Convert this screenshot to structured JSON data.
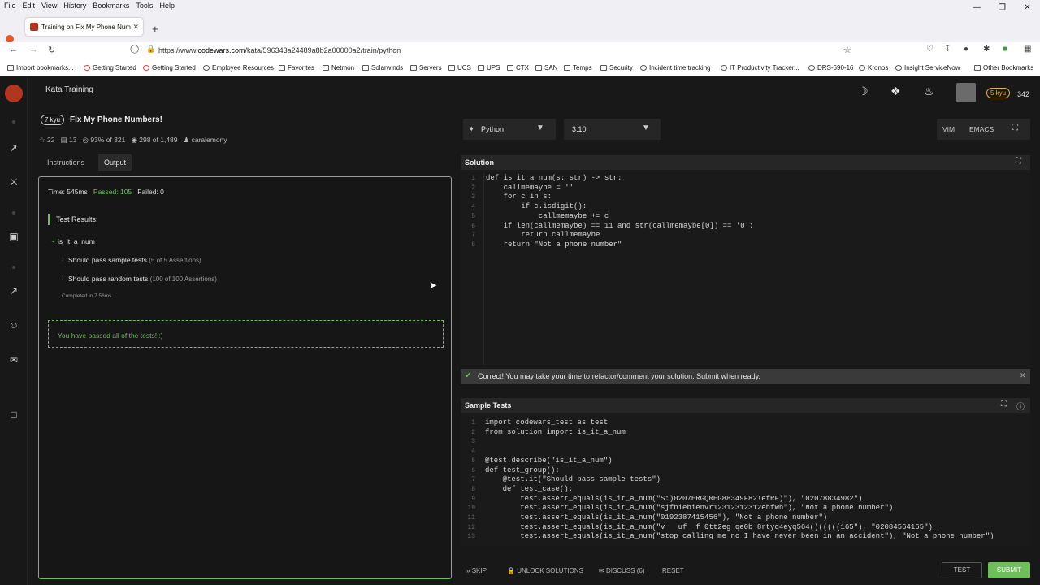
{
  "browser": {
    "menu": [
      "File",
      "Edit",
      "View",
      "History",
      "Bookmarks",
      "Tools",
      "Help"
    ],
    "tab_title": "Training on Fix My Phone Num",
    "url_prefix": "https://www.",
    "url_domain": "codewars.com",
    "url_path": "/kata/596343a24489a8b2a00000a2/train/python",
    "bookmarks": [
      "Import bookmarks...",
      "Getting Started",
      "Getting Started",
      "Employee Resources",
      "Favorites",
      "Netmon",
      "Solarwinds",
      "Servers",
      "UCS",
      "UPS",
      "CTX",
      "SAN",
      "Temps",
      "Security",
      "Incident time tracking",
      "IT Productivity Tracker...",
      "DRS-690-16",
      "Kronos",
      "Insight ServiceNow",
      "Other Bookmarks"
    ]
  },
  "app": {
    "section": "Kata Training",
    "user_rank": "5 kyu",
    "honor": "342"
  },
  "kata": {
    "rank": "7 kyu",
    "title": "Fix My Phone Numbers!",
    "stars": "22",
    "collections": "13",
    "satisfaction": "93% of 321",
    "completed": "298 of 1,489",
    "author": "caralemony",
    "tabs": [
      "Instructions",
      "Output"
    ]
  },
  "output": {
    "time": "Time: 545ms",
    "passed": "Passed: 105",
    "failed": "Failed: 0",
    "results_label": "Test Results:",
    "group": "is_it_a_num",
    "tests": [
      {
        "name": "Should pass sample tests",
        "count": "(5 of 5 Assertions)"
      },
      {
        "name": "Should pass random tests",
        "count": "(100 of 100 Assertions)"
      }
    ],
    "completed_in": "Completed in 7.56ms",
    "message": "You have passed all of the tests! :)"
  },
  "editor": {
    "language": "Python",
    "version": "3.10",
    "modes": [
      "VIM",
      "EMACS"
    ],
    "solution_label": "Solution",
    "solution_code": [
      "def is_it_a_num(s: str) -> str:",
      "    callmemaybe = ''",
      "    for c in s:",
      "        if c.isdigit():",
      "            callmemaybe += c",
      "    if len(callmemaybe) == 11 and str(callmemaybe[0]) == '0':",
      "        return callmemaybe",
      "    return \"Not a phone number\""
    ],
    "notice": "Correct! You may take your time to refactor/comment your solution. Submit when ready.",
    "sample_label": "Sample Tests",
    "sample_code": [
      "import codewars_test as test",
      "from solution import is_it_a_num",
      "",
      "",
      "@test.describe(\"is_it_a_num\")",
      "def test_group():",
      "    @test.it(\"Should pass sample tests\")",
      "    def test_case():",
      "        test.assert_equals(is_it_a_num(\"S:)0207ERGQREG88349F82!efRF)\"), \"02078834982\")",
      "        test.assert_equals(is_it_a_num(\"sjfniebienvr12312312312ehfWh\"), \"Not a phone number\")",
      "        test.assert_equals(is_it_a_num(\"0192387415456\"), \"Not a phone number\")",
      "        test.assert_equals(is_it_a_num(\"v   uf  f 0tt2eg qe0b 8rtyq4eyq564()(((((165\"), \"02084564165\")",
      "        test.assert_equals(is_it_a_num(\"stop calling me no I have never been in an accident\"), \"Not a phone number\")"
    ]
  },
  "actions": {
    "skip": "SKIP",
    "unlock": "UNLOCK SOLUTIONS",
    "discuss": "DISCUSS (6)",
    "reset": "RESET",
    "test": "TEST",
    "submit": "SUBMIT"
  },
  "colors": {
    "brand": "#b1361e",
    "passed": "#6fbd5b",
    "panel_border": "#6fbd5b",
    "submit": "#6fbd5b"
  }
}
